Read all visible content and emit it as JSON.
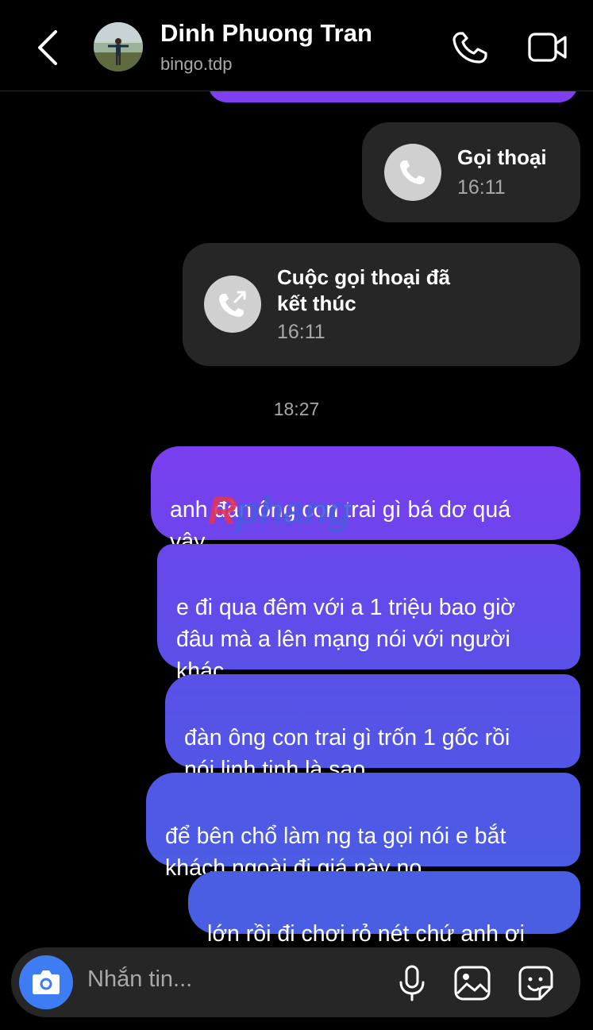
{
  "header": {
    "name": "Dinh Phuong Tran",
    "handle": "bingo.tdp"
  },
  "icons": {
    "back": "chevron-left-icon",
    "call": "phone-icon",
    "video": "video-camera-icon"
  },
  "calls": [
    {
      "title": "Gọi thoại",
      "time": "16:11",
      "icon": "phone-icon"
    },
    {
      "title": "Cuộc gọi thoại đã\nkết thúc",
      "time": "16:11",
      "icon": "phone-ended-icon"
    }
  ],
  "timestamp": "18:27",
  "messages": [
    {
      "text": "anh đàn ông con trai gì bá dơ quá\nvậy"
    },
    {
      "text": "e đi qua đêm với a 1 triệu bao giờ\nđâu mà a lên mạng nói với người\nkhác"
    },
    {
      "text": "đàn ông con trai gì trốn 1 gốc rồi\nnói linh tinh là sao"
    },
    {
      "text": "để bên chổ làm ng ta gọi nói e bắt\nkhách ngoài đi giá này nọ"
    },
    {
      "text": "lớn rồi đi chơi rỏ nét chứ anh ơi"
    }
  ],
  "watermark": {
    "first": "R",
    "rest": "phang"
  },
  "composer": {
    "placeholder": "Nhắn tin..."
  },
  "colors": {
    "bubble_top": "#7d3ff0",
    "bubble_bottom": "#4b5ee3",
    "call_card": "#262626",
    "camera_button": "#3d7cf2"
  }
}
